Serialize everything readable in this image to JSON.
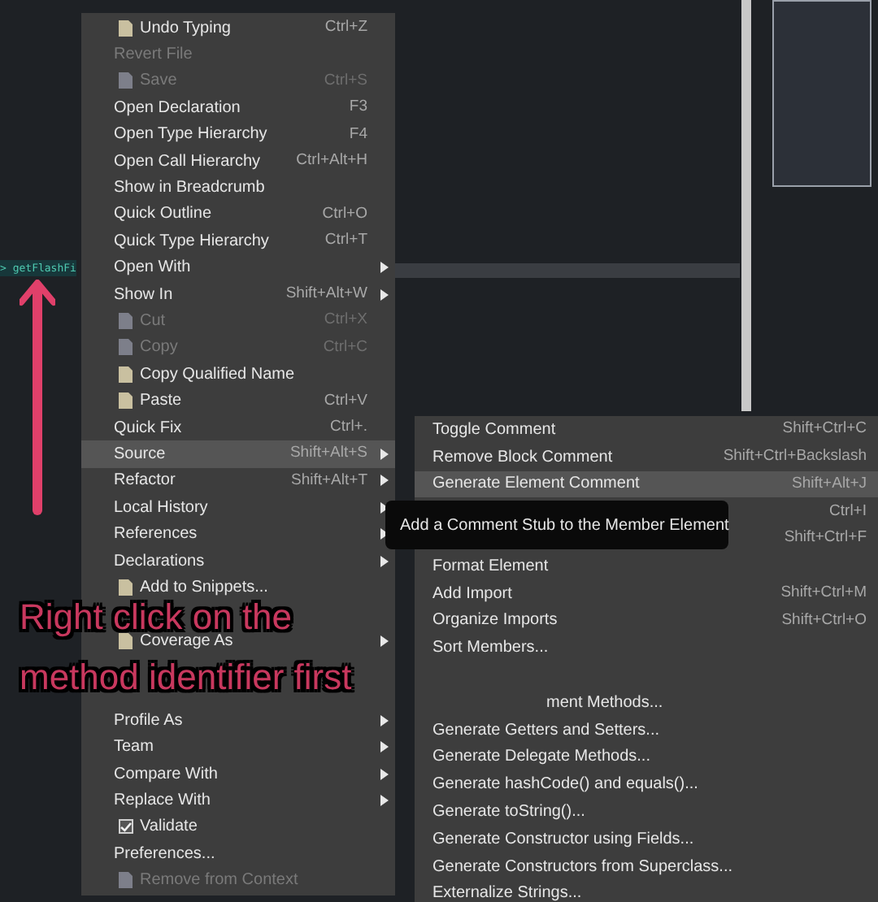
{
  "editor": {
    "highlighted_token": "> getFlashFi"
  },
  "context_menu": {
    "items": [
      {
        "kind": "item",
        "label": "Undo Typing",
        "shortcut": "Ctrl+Z",
        "icon": true,
        "disabled": false,
        "selected": false,
        "submenu": false
      },
      {
        "kind": "item",
        "label": "Revert File",
        "disabled": true,
        "selected": false,
        "submenu": false
      },
      {
        "kind": "item",
        "label": "Save",
        "shortcut": "Ctrl+S",
        "icon": true,
        "disabled": true,
        "selected": false,
        "submenu": false
      },
      {
        "kind": "item",
        "label": "Open Declaration",
        "shortcut": "F3",
        "disabled": false,
        "selected": false,
        "submenu": false
      },
      {
        "kind": "item",
        "label": "Open Type Hierarchy",
        "shortcut": "F4",
        "disabled": false,
        "selected": false,
        "submenu": false
      },
      {
        "kind": "item",
        "label": "Open Call Hierarchy",
        "shortcut": "Ctrl+Alt+H",
        "disabled": false,
        "selected": false,
        "submenu": false
      },
      {
        "kind": "item",
        "label": "Show in Breadcrumb",
        "disabled": false,
        "selected": false,
        "submenu": false
      },
      {
        "kind": "item",
        "label": "Quick Outline",
        "shortcut": "Ctrl+O",
        "disabled": false,
        "selected": false,
        "submenu": false
      },
      {
        "kind": "item",
        "label": "Quick Type Hierarchy",
        "shortcut": "Ctrl+T",
        "disabled": false,
        "selected": false,
        "submenu": false
      },
      {
        "kind": "item",
        "label": "Open With",
        "disabled": false,
        "selected": false,
        "submenu": true
      },
      {
        "kind": "item",
        "label": "Show In",
        "shortcut": "Shift+Alt+W",
        "disabled": false,
        "selected": false,
        "submenu": true
      },
      {
        "kind": "item",
        "label": "Cut",
        "shortcut": "Ctrl+X",
        "icon": true,
        "disabled": true,
        "selected": false,
        "submenu": false
      },
      {
        "kind": "item",
        "label": "Copy",
        "shortcut": "Ctrl+C",
        "icon": true,
        "disabled": true,
        "selected": false,
        "submenu": false
      },
      {
        "kind": "item",
        "label": "Copy Qualified Name",
        "icon": true,
        "disabled": false,
        "selected": false,
        "submenu": false
      },
      {
        "kind": "item",
        "label": "Paste",
        "shortcut": "Ctrl+V",
        "icon": true,
        "disabled": false,
        "selected": false,
        "submenu": false
      },
      {
        "kind": "item",
        "label": "Quick Fix",
        "shortcut": "Ctrl+.",
        "disabled": false,
        "selected": false,
        "submenu": false
      },
      {
        "kind": "item",
        "label": "Source",
        "shortcut": "Shift+Alt+S",
        "disabled": false,
        "selected": true,
        "submenu": true
      },
      {
        "kind": "item",
        "label": "Refactor",
        "shortcut": "Shift+Alt+T",
        "disabled": false,
        "selected": false,
        "submenu": true
      },
      {
        "kind": "item",
        "label": "Local History",
        "disabled": false,
        "selected": false,
        "submenu": true
      },
      {
        "kind": "item",
        "label": "References",
        "disabled": false,
        "selected": false,
        "submenu": true
      },
      {
        "kind": "item",
        "label": "Declarations",
        "disabled": false,
        "selected": false,
        "submenu": true
      },
      {
        "kind": "item",
        "label": "Add to Snippets...",
        "icon": true,
        "disabled": false,
        "selected": false,
        "submenu": false
      },
      {
        "kind": "obscured"
      },
      {
        "kind": "item",
        "label": "Coverage As",
        "icon": true,
        "disabled": false,
        "selected": false,
        "submenu": true
      },
      {
        "kind": "obscured"
      },
      {
        "kind": "obscured"
      },
      {
        "kind": "item",
        "label": "Profile As",
        "disabled": false,
        "selected": false,
        "submenu": true
      },
      {
        "kind": "item",
        "label": "Team",
        "disabled": false,
        "selected": false,
        "submenu": true
      },
      {
        "kind": "item",
        "label": "Compare With",
        "disabled": false,
        "selected": false,
        "submenu": true
      },
      {
        "kind": "item",
        "label": "Replace With",
        "disabled": false,
        "selected": false,
        "submenu": true
      },
      {
        "kind": "check",
        "label": "Validate",
        "checked": true,
        "disabled": false,
        "selected": false,
        "submenu": false
      },
      {
        "kind": "item",
        "label": "Preferences...",
        "disabled": false,
        "selected": false,
        "submenu": false
      },
      {
        "kind": "item",
        "label": "Remove from Context",
        "icon": true,
        "disabled": true,
        "selected": false,
        "submenu": false
      }
    ]
  },
  "source_submenu": {
    "items": [
      {
        "kind": "item",
        "label": "Toggle Comment",
        "shortcut": "Shift+Ctrl+C",
        "selected": false
      },
      {
        "kind": "item",
        "label": "Remove Block Comment",
        "shortcut": "Shift+Ctrl+Backslash",
        "selected": false
      },
      {
        "kind": "item",
        "label": "Generate Element Comment",
        "shortcut": "Shift+Alt+J",
        "selected": true
      },
      {
        "kind": "obscured",
        "shortcut": "Ctrl+I"
      },
      {
        "kind": "obscured",
        "shortcut": "Shift+Ctrl+F"
      },
      {
        "kind": "item",
        "label": "Format Element",
        "selected": false
      },
      {
        "kind": "item",
        "label": "Add Import",
        "shortcut": "Shift+Ctrl+M",
        "selected": false
      },
      {
        "kind": "item",
        "label": "Organize Imports",
        "shortcut": "Shift+Ctrl+O",
        "selected": false
      },
      {
        "kind": "item",
        "label": "Sort Members...",
        "selected": false
      },
      {
        "kind": "obscured"
      },
      {
        "kind": "partial",
        "label": "ment Methods..."
      },
      {
        "kind": "item",
        "label": "Generate Getters and Setters...",
        "selected": false
      },
      {
        "kind": "item",
        "label": "Generate Delegate Methods...",
        "selected": false
      },
      {
        "kind": "item",
        "label": "Generate hashCode() and equals()...",
        "selected": false
      },
      {
        "kind": "item",
        "label": "Generate toString()...",
        "selected": false
      },
      {
        "kind": "item",
        "label": "Generate Constructor using Fields...",
        "selected": false
      },
      {
        "kind": "item",
        "label": "Generate Constructors from Superclass...",
        "selected": false
      },
      {
        "kind": "item",
        "label": "Externalize Strings...",
        "selected": false
      }
    ]
  },
  "tooltip": {
    "text": "Add a Comment Stub to the Member Element"
  },
  "annotation": {
    "lines": [
      "Right click on the",
      "method identifier first"
    ]
  }
}
